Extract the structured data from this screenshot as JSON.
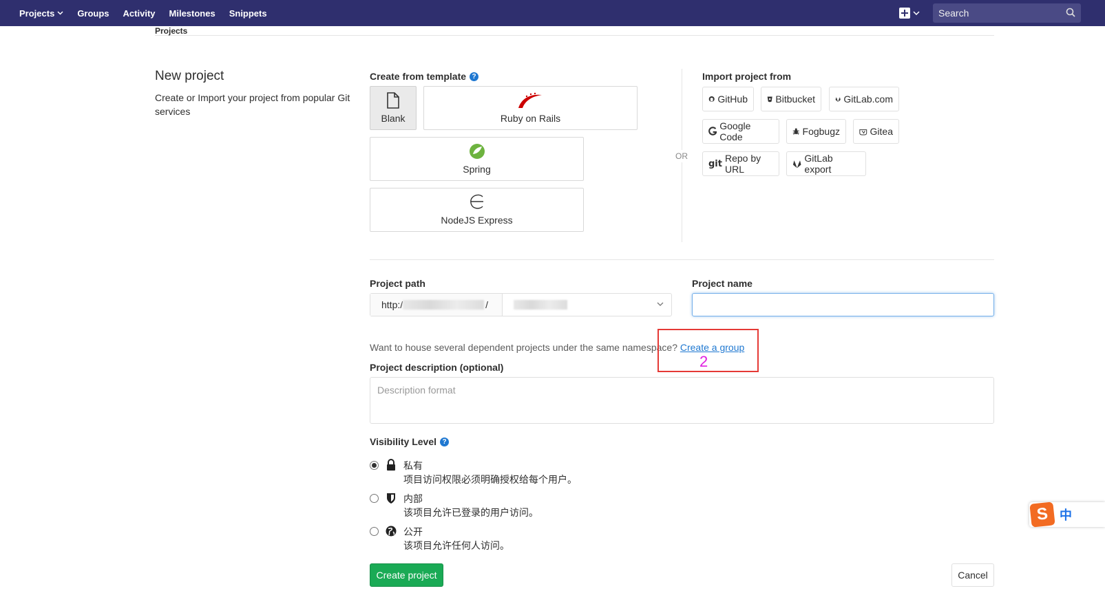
{
  "nav": {
    "items": [
      {
        "label": "Projects",
        "has_dropdown": true
      },
      {
        "label": "Groups"
      },
      {
        "label": "Activity"
      },
      {
        "label": "Milestones"
      },
      {
        "label": "Snippets"
      }
    ],
    "search_placeholder": "Search",
    "colors": {
      "bar": "#2f2f6e",
      "search": "#4a4a85"
    }
  },
  "breadcrumb": "Projects",
  "intro": {
    "title": "New project",
    "description": "Create or Import your project from popular Git services"
  },
  "templates": {
    "heading": "Create from template",
    "items": [
      {
        "label": "Blank",
        "icon": "file-icon",
        "selected": true
      },
      {
        "label": "Ruby on Rails",
        "icon": "rails-icon"
      },
      {
        "label": "Spring",
        "icon": "spring-icon"
      },
      {
        "label": "NodeJS Express",
        "icon": "express-icon"
      }
    ]
  },
  "or_label": "OR",
  "import": {
    "heading": "Import project from",
    "items": [
      {
        "label": "GitHub",
        "icon": "github-icon"
      },
      {
        "label": "Bitbucket",
        "icon": "bitbucket-icon"
      },
      {
        "label": "GitLab.com",
        "icon": "gitlab-icon"
      },
      {
        "label": "Google Code",
        "icon": "google-icon"
      },
      {
        "label": "Fogbugz",
        "icon": "bug-icon"
      },
      {
        "label": "Gitea",
        "icon": "gitea-icon"
      },
      {
        "label": "Repo by URL",
        "icon": "git-icon"
      },
      {
        "label": "GitLab export",
        "icon": "gitlab-icon"
      }
    ]
  },
  "form": {
    "path_label": "Project path",
    "path_prefix": "http:/",
    "path_suffix": "/",
    "name_label": "Project name",
    "name_value": "",
    "group_hint": "Want to house several dependent projects under the same namespace?",
    "group_link": "Create a group",
    "annotation_number": "2",
    "description_label": "Project description (optional)",
    "description_placeholder": "Description format",
    "visibility_label": "Visibility Level",
    "visibility_options": [
      {
        "title": "私有",
        "desc": "项目访问权限必须明确授权给每个用户。",
        "checked": true,
        "icon": "lock-icon"
      },
      {
        "title": "内部",
        "desc": "该项目允许已登录的用户访问。",
        "checked": false,
        "icon": "shield-icon"
      },
      {
        "title": "公开",
        "desc": "该项目允许任何人访问。",
        "checked": false,
        "icon": "globe-icon"
      }
    ],
    "create_button": "Create project",
    "cancel_button": "Cancel"
  },
  "ime": {
    "logo": "S",
    "mode": "中"
  }
}
